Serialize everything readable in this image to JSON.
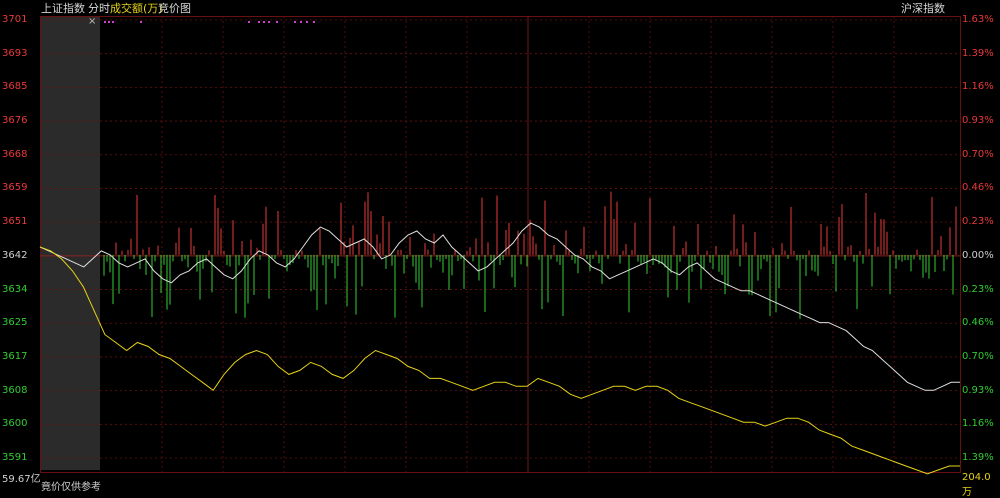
{
  "header": {
    "index_name": "上证指数",
    "tab_timeshare": "分时",
    "tab_volume": "成交额(万)",
    "tab_auction": "竞价图",
    "right_link": "沪深指数"
  },
  "auction": {
    "close_symbol": "×",
    "bottom_label": "竟价仅供参考"
  },
  "left_axis": {
    "ticks": [
      "3701",
      "3693",
      "3685",
      "3676",
      "3668",
      "3659",
      "3651",
      "3642",
      "3634",
      "3625",
      "3617",
      "3608",
      "3600",
      "3591"
    ],
    "bottom_value": "59.67亿"
  },
  "right_axis": {
    "ticks": [
      "1.63%",
      "1.39%",
      "1.16%",
      "0.93%",
      "0.70%",
      "0.46%",
      "0.23%",
      "0.00%",
      "0.23%",
      "0.46%",
      "0.70%",
      "0.93%",
      "1.16%",
      "1.39%"
    ],
    "bottom_value": "204.0万"
  },
  "colors": {
    "background": "#000000",
    "up": "#e83a3a",
    "down": "#33cc33",
    "price_line": "#e0e0e0",
    "avg_line": "#e6d317",
    "grid": "#6b1010",
    "auction_bg": "#2b2b2b",
    "marker": "#d040d0"
  },
  "chart_data": {
    "type": "line",
    "ylim": [
      3591,
      3701
    ],
    "baseline": 3642,
    "series": [
      {
        "values": [
          3644,
          3643,
          3642,
          3641,
          3640,
          3639,
          3641,
          3643,
          3642,
          3640,
          3639,
          3640,
          3641,
          3638,
          3636,
          3635,
          3637,
          3638,
          3640,
          3641,
          3639,
          3637,
          3636,
          3638,
          3641,
          3643,
          3642,
          3640,
          3639,
          3641,
          3644,
          3647,
          3649,
          3648,
          3646,
          3644,
          3645,
          3646,
          3644,
          3641,
          3642,
          3645,
          3647,
          3648,
          3646,
          3645,
          3647,
          3644,
          3642,
          3640,
          3638,
          3639,
          3641,
          3643,
          3645,
          3648,
          3650,
          3649,
          3647,
          3646,
          3644,
          3642,
          3641,
          3639,
          3638,
          3636,
          3637,
          3638,
          3639,
          3640,
          3641,
          3640,
          3638,
          3637,
          3639,
          3640,
          3638,
          3636,
          3635,
          3634,
          3633,
          3633,
          3632,
          3631,
          3630,
          3629,
          3628,
          3627,
          3626,
          3625,
          3625,
          3624,
          3623,
          3621,
          3619,
          3618,
          3616,
          3614,
          3612,
          3610,
          3609,
          3608,
          3608,
          3609,
          3610,
          3610
        ],
        "stroke": "#e0e0e0"
      },
      {
        "values": [
          3644,
          3643,
          3641,
          3638,
          3634,
          3628,
          3622,
          3620,
          3618,
          3620,
          3619,
          3617,
          3616,
          3614,
          3612,
          3610,
          3608,
          3612,
          3615,
          3617,
          3618,
          3617,
          3614,
          3612,
          3613,
          3615,
          3614,
          3612,
          3611,
          3613,
          3616,
          3618,
          3617,
          3616,
          3614,
          3613,
          3611,
          3611,
          3610,
          3609,
          3608,
          3609,
          3610,
          3610,
          3609,
          3609,
          3611,
          3610,
          3609,
          3607,
          3606,
          3607,
          3608,
          3609,
          3609,
          3608,
          3609,
          3609,
          3608,
          3606,
          3605,
          3604,
          3603,
          3602,
          3601,
          3600,
          3600,
          3599,
          3600,
          3601,
          3601,
          3600,
          3598,
          3597,
          3596,
          3594,
          3593,
          3592,
          3591,
          3590,
          3589,
          3588,
          3587,
          3588,
          3589,
          3589
        ],
        "stroke": "#e6d317"
      }
    ]
  }
}
